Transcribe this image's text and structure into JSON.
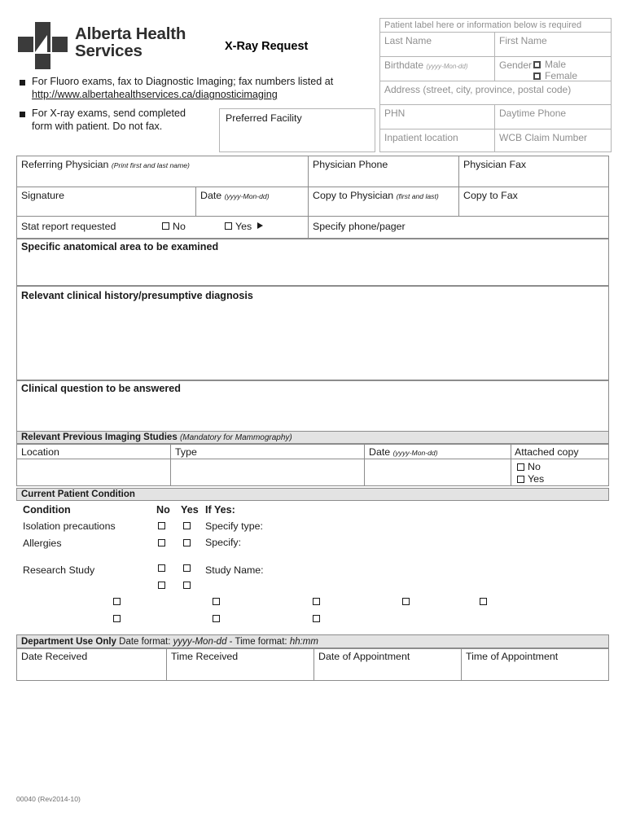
{
  "header": {
    "org_name_line1": "Alberta Health",
    "org_name_line2": "Services",
    "logo_icon": "ahs-cross-logo",
    "form_title": "X-Ray Request"
  },
  "instructions": [
    {
      "bullet_icon": "square-bullet-icon",
      "text": "For Fluoro exams, fax to Diagnostic Imaging; fax numbers listed at",
      "link": "http://www.albertahealthservices.ca/diagnosticimaging"
    },
    {
      "bullet_icon": "square-bullet-icon",
      "line1": "For X-ray exams, send completed",
      "line2": "form with patient. Do not fax."
    }
  ],
  "preferred_facility": {
    "label": "Preferred Facility",
    "value": ""
  },
  "patient_label": {
    "banner": "Patient label here or information below is required",
    "fields": {
      "last_name": {
        "label": "Last Name",
        "value": ""
      },
      "first_name": {
        "label": "First Name",
        "value": ""
      },
      "birthdate": {
        "label": "Birthdate",
        "hint": "(yyyy-Mon-dd)",
        "value": ""
      },
      "gender": {
        "label": "Gender",
        "options": [
          {
            "label": "Male",
            "checked": false
          },
          {
            "label": "Female",
            "checked": false
          }
        ]
      },
      "address": {
        "label": "Address (street, city, province, postal code)",
        "value": ""
      },
      "phn": {
        "label": "PHN",
        "value": ""
      },
      "daytime_phone": {
        "label": "Daytime Phone",
        "value": ""
      },
      "inpatient_location": {
        "label": "Inpatient location",
        "value": ""
      },
      "wcb_claim_number": {
        "label": "WCB Claim Number",
        "value": ""
      }
    }
  },
  "physician": {
    "referring_physician": {
      "label": "Referring Physician",
      "hint": "(Print first and last name)",
      "value": ""
    },
    "physician_phone": {
      "label": "Physician Phone",
      "value": ""
    },
    "physician_fax": {
      "label": "Physician Fax",
      "value": ""
    },
    "signature": {
      "label": "Signature",
      "value": ""
    },
    "date": {
      "label": "Date",
      "hint": "(yyyy-Mon-dd)",
      "value": ""
    },
    "copy_to_physician": {
      "label": "Copy to Physician",
      "hint": "(first and last)",
      "value": ""
    },
    "copy_to_fax": {
      "label": "Copy to Fax",
      "value": ""
    },
    "stat_report": {
      "label": "Stat report requested",
      "options": [
        {
          "label": "No",
          "checked": false
        },
        {
          "label": "Yes",
          "checked": false
        }
      ],
      "arrow_icon": "right-triangle-icon",
      "specify": {
        "label": "Specify phone/pager",
        "value": ""
      }
    }
  },
  "clinical": {
    "anatomical_area": {
      "label": "Specific anatomical area to be examined",
      "value": ""
    },
    "history": {
      "label": "Relevant clinical history/presumptive diagnosis",
      "value": ""
    },
    "question": {
      "label": "Clinical question to be answered",
      "value": ""
    }
  },
  "previous_imaging": {
    "section_title": "Relevant Previous Imaging Studies",
    "section_hint": "(Mandatory for Mammography)",
    "columns": [
      "Location",
      "Type",
      "Date",
      "Attached copy"
    ],
    "date_hint": "(yyyy-Mon-dd)",
    "rows": [
      {
        "location": "",
        "type": "",
        "date": ""
      }
    ],
    "attached_copy_options": [
      {
        "label": "No",
        "checked": false
      },
      {
        "label": "Yes",
        "checked": false
      }
    ]
  },
  "current_condition": {
    "section_title": "Current Patient Condition",
    "col_condition": "Condition",
    "col_no": "No",
    "col_yes": "Yes",
    "col_if_yes": "If Yes:",
    "rows": [
      {
        "condition": "Isolation precautions",
        "no_checked": false,
        "yes_checked": false,
        "if_yes": "Specify type:",
        "if_yes_value": ""
      },
      {
        "condition": "Allergies",
        "no_checked": false,
        "yes_checked": false,
        "if_yes": "Specify:",
        "if_yes_value": ""
      },
      {
        "condition": "Research Study",
        "no_checked": false,
        "yes_checked": false,
        "if_yes": "Study Name:",
        "if_yes_value": ""
      }
    ]
  },
  "department_use": {
    "section_title": "Department Use Only",
    "format_note_prefix": "Date format:",
    "date_format": "yyyy-Mon-dd",
    "format_note_separator": "- Time format:",
    "time_format": "hh:mm",
    "fields": [
      {
        "label": "Date Received",
        "value": ""
      },
      {
        "label": "Time Received",
        "value": ""
      },
      {
        "label": "Date of Appointment",
        "value": ""
      },
      {
        "label": "Time of Appointment",
        "value": ""
      }
    ]
  },
  "footer": {
    "form_code": "00040 (Rev2014-10)"
  }
}
